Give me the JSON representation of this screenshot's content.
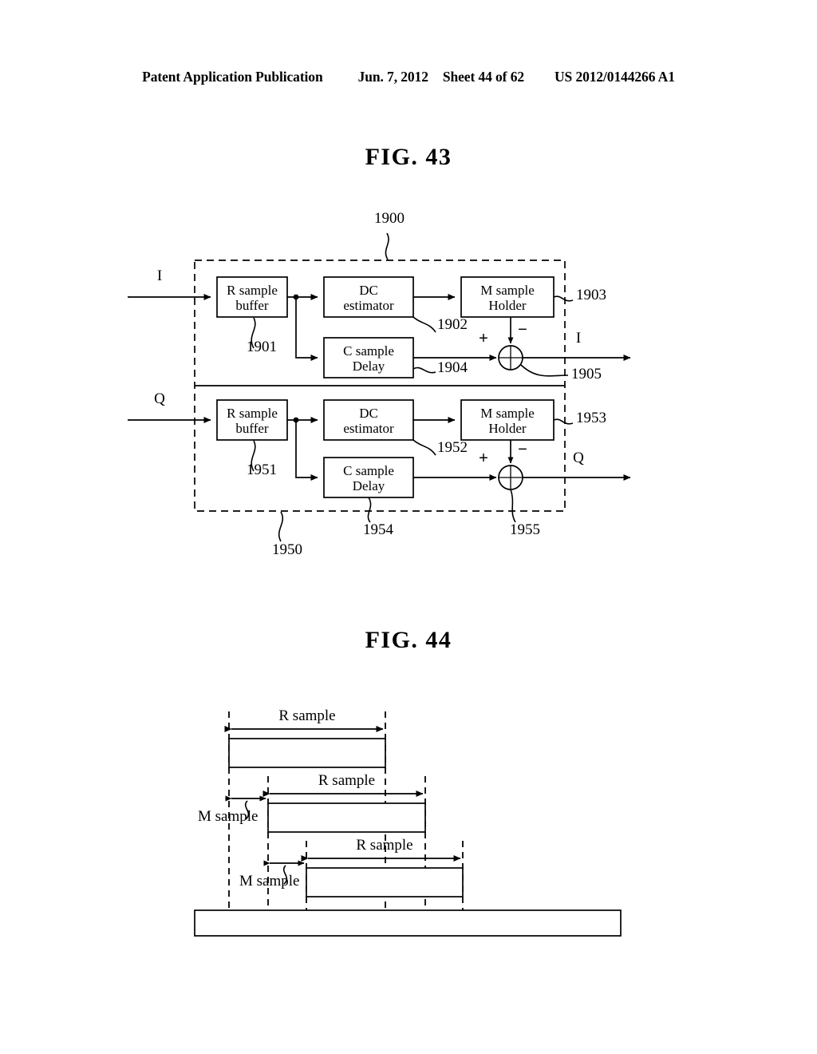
{
  "header": {
    "publication": "Patent Application Publication",
    "date": "Jun. 7, 2012",
    "sheet": "Sheet 44 of 62",
    "pub_number": "US 2012/0144266 A1"
  },
  "figures": [
    {
      "title": "FIG. 43",
      "group_ref": "1900",
      "group_ref_lower": "1950",
      "branches": [
        {
          "input_label": "I",
          "output_label": "I",
          "blocks": [
            {
              "ref": "1901",
              "line1": "R sample",
              "line2": "buffer"
            },
            {
              "ref": "1902",
              "line1": "DC",
              "line2": "estimator"
            },
            {
              "ref": "1903",
              "line1": "M sample",
              "line2": "Holder"
            },
            {
              "ref": "1904",
              "line1": "C sample",
              "line2": "Delay"
            }
          ],
          "adder": {
            "ref": "1905",
            "plus": "+",
            "minus": "−"
          }
        },
        {
          "input_label": "Q",
          "output_label": "Q",
          "blocks": [
            {
              "ref": "1951",
              "line1": "R sample",
              "line2": "buffer"
            },
            {
              "ref": "1952",
              "line1": "DC",
              "line2": "estimator"
            },
            {
              "ref": "1953",
              "line1": "M sample",
              "line2": "Holder"
            },
            {
              "ref": "1954",
              "line1": "C sample",
              "line2": "Delay"
            }
          ],
          "adder": {
            "ref": "1955",
            "plus": "+",
            "minus": "−"
          }
        }
      ]
    },
    {
      "title": "FIG. 44",
      "rows": [
        {
          "r_label": "R sample",
          "m_label": ""
        },
        {
          "r_label": "R sample",
          "m_label": "M sample"
        },
        {
          "r_label": "R sample",
          "m_label": "M sample"
        }
      ]
    }
  ]
}
